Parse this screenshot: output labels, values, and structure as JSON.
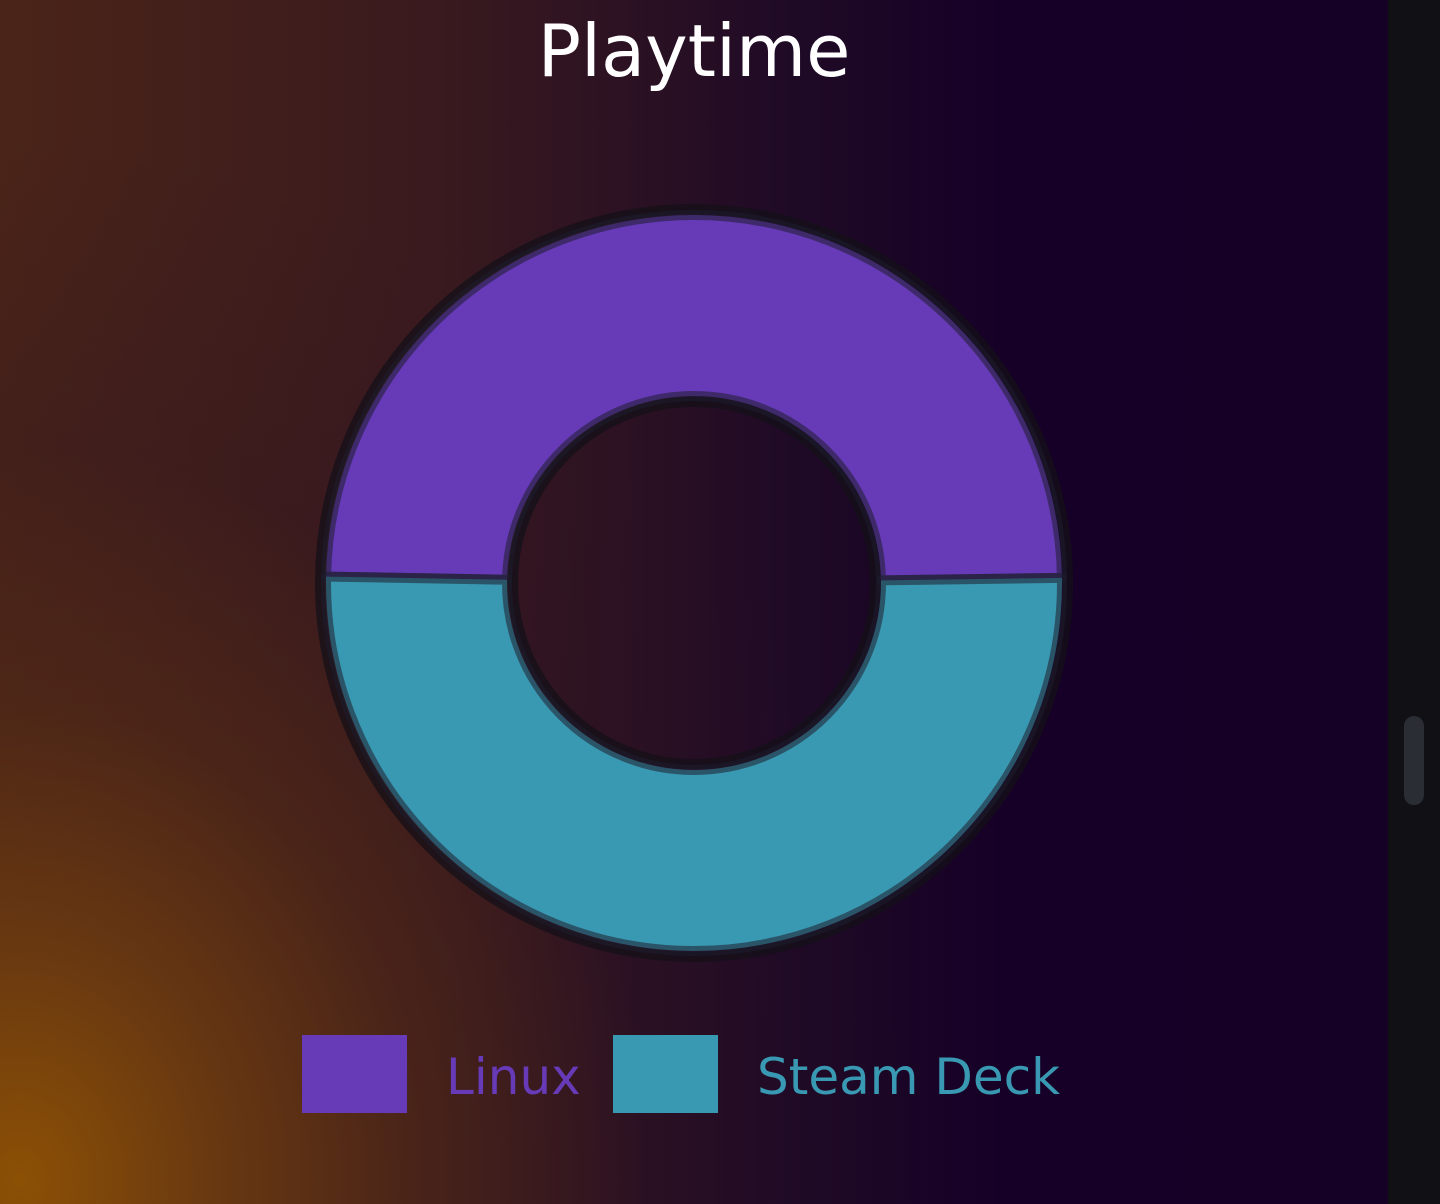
{
  "chart_data": {
    "type": "pie",
    "title": "Playtime",
    "donut": true,
    "slices": [
      {
        "label": "Linux",
        "value": 49.5,
        "color": "#673ab7"
      },
      {
        "label": "Steam Deck",
        "value": 50.5,
        "color": "#3a99b2"
      }
    ],
    "legend_position": "bottom"
  }
}
